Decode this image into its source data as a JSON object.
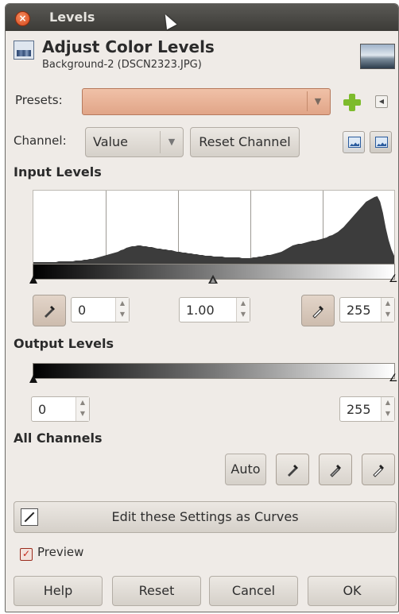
{
  "window": {
    "title": "Levels"
  },
  "header": {
    "title": "Adjust Color Levels",
    "subtitle": "Background-2 (DSCN2323.JPG)"
  },
  "presets": {
    "label": "Presets:",
    "value": ""
  },
  "channel": {
    "label": "Channel:",
    "value": "Value",
    "reset_label": "Reset Channel"
  },
  "input_levels": {
    "heading": "Input Levels",
    "low": "0",
    "gamma": "1.00",
    "high": "255",
    "histogram": [
      2,
      2,
      2,
      2,
      2,
      2,
      2,
      2,
      2,
      3,
      3,
      3,
      3,
      3,
      3,
      4,
      4,
      4,
      5,
      5,
      6,
      6,
      7,
      8,
      9,
      10,
      11,
      12,
      13,
      14,
      15,
      17,
      18,
      20,
      21,
      22,
      22,
      23,
      23,
      22,
      22,
      21,
      21,
      20,
      19,
      19,
      18,
      18,
      17,
      17,
      16,
      15,
      15,
      14,
      14,
      13,
      13,
      12,
      12,
      11,
      11,
      10,
      10,
      10,
      9,
      9,
      9,
      9,
      8,
      8,
      8,
      8,
      8,
      8,
      7,
      7,
      7,
      7,
      8,
      8,
      9,
      9,
      10,
      11,
      11,
      12,
      13,
      14,
      15,
      17,
      19,
      21,
      23,
      24,
      25,
      25,
      26,
      27,
      28,
      29,
      29,
      30,
      31,
      32,
      33,
      35,
      36,
      38,
      40,
      43,
      46,
      50,
      54,
      58,
      62,
      66,
      70,
      74,
      78,
      80,
      82,
      84,
      85,
      78,
      64,
      45,
      30,
      18,
      10
    ]
  },
  "output_levels": {
    "heading": "Output Levels",
    "low": "0",
    "high": "255"
  },
  "all_channels": {
    "heading": "All Channels",
    "auto_label": "Auto"
  },
  "curves_button": {
    "label": "Edit these Settings as Curves"
  },
  "preview": {
    "label": "Preview",
    "checked": true
  },
  "buttons": {
    "help": "Help",
    "reset": "Reset",
    "cancel": "Cancel",
    "ok": "OK"
  }
}
